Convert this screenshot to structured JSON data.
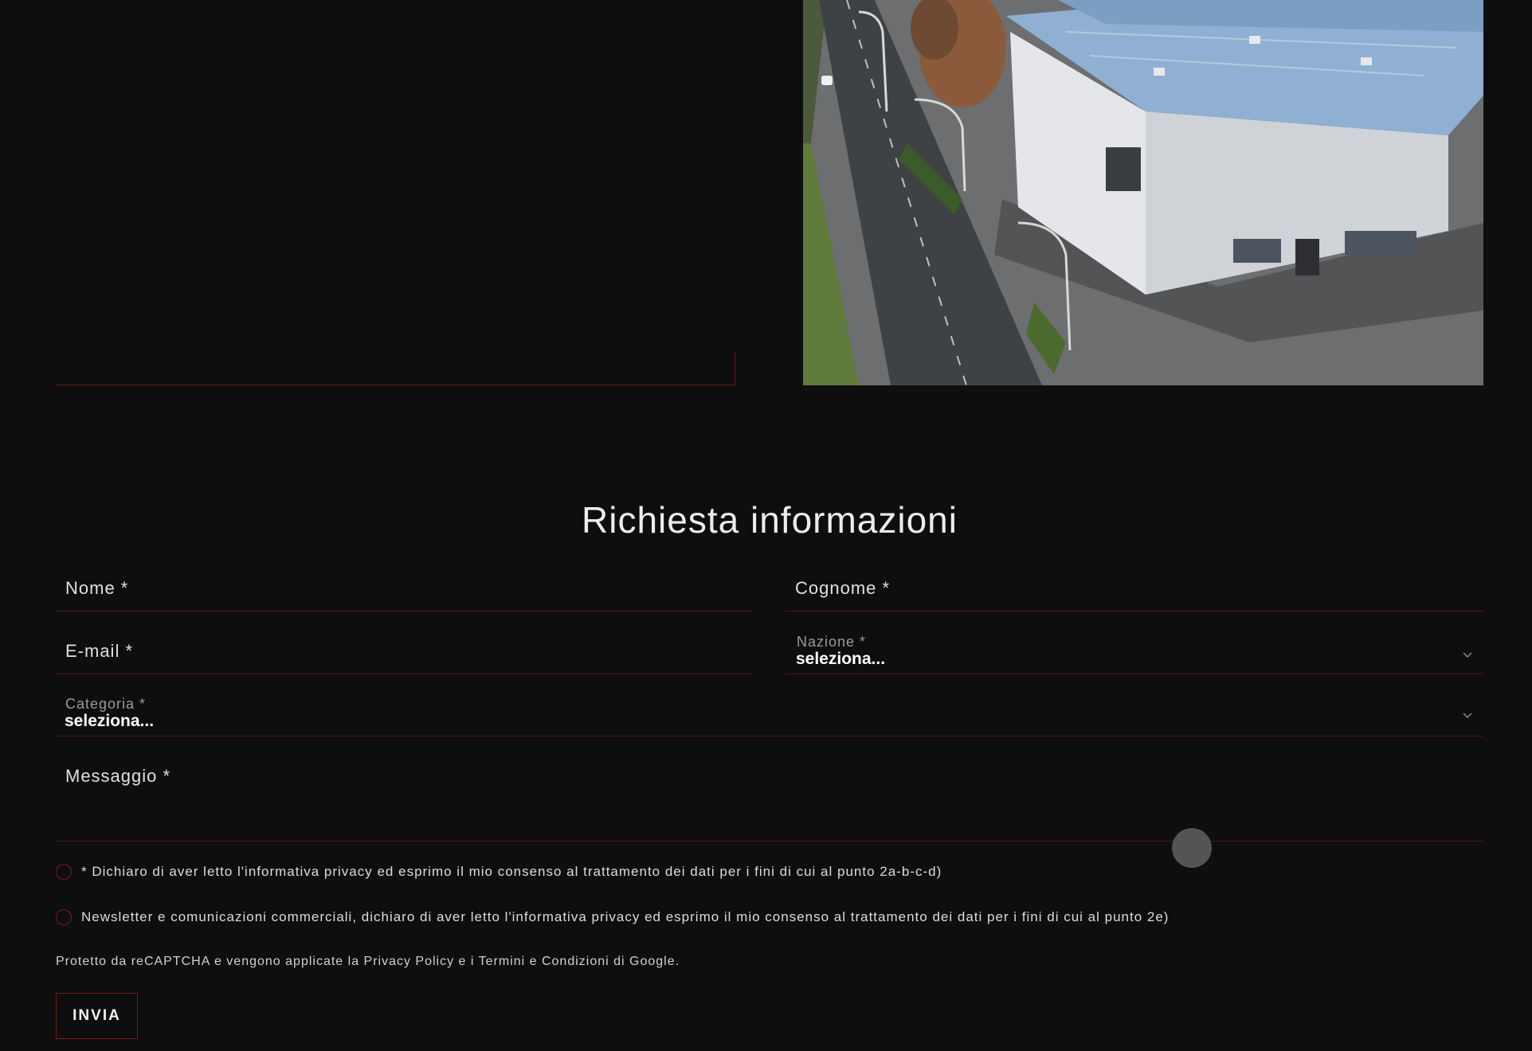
{
  "form": {
    "title": "Richiesta informazioni",
    "fields": {
      "nome": "Nome *",
      "cognome": "Cognome *",
      "email": "E-mail *",
      "nazione_label": "Nazione *",
      "nazione_value": "seleziona...",
      "categoria_label": "Categoria *",
      "categoria_value": "seleziona...",
      "messaggio": "Messaggio *"
    },
    "consents": [
      "* Dichiaro di aver letto l'informativa privacy ed esprimo il mio consenso al trattamento dei dati per i fini di cui al punto 2a-b-c-d)",
      "Newsletter e comunicazioni commerciali, dichiaro di aver letto l'informativa privacy ed esprimo il mio consenso al trattamento dei dati per i fini di cui al punto 2e)"
    ],
    "recaptcha_text": "Protetto da reCAPTCHA e vengono applicate la Privacy Policy e i Termini e Condizioni di Google.",
    "submit_label": "INVIA"
  },
  "icons": {
    "dropdown": "chevron-down-icon",
    "cursor": "cursor-dot"
  },
  "colors": {
    "background": "#0e0e0f",
    "accent_line": "#6a1515",
    "text": "#e6e6e6"
  }
}
